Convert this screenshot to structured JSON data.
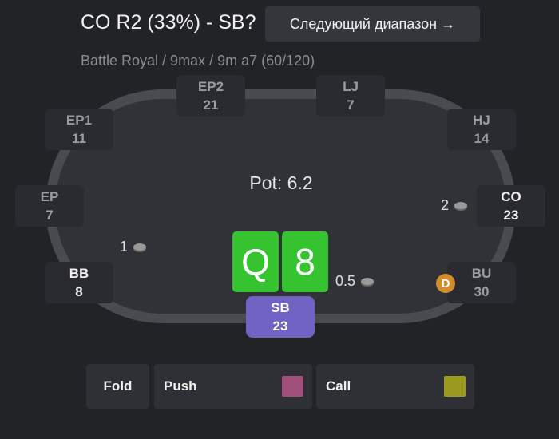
{
  "header": {
    "title": "CO R2 (33%) - SB?",
    "next_button": "Следующий диапазон →",
    "subtitle": "Battle Royal / 9max / 9m a7 (60/120)"
  },
  "table": {
    "pot": "Pot: 6.2",
    "seats": {
      "ep2": {
        "position": "EP2",
        "stack": "21"
      },
      "lj": {
        "position": "LJ",
        "stack": "7"
      },
      "ep1": {
        "position": "EP1",
        "stack": "11"
      },
      "hj": {
        "position": "HJ",
        "stack": "14"
      },
      "ep": {
        "position": "EP",
        "stack": "7"
      },
      "co": {
        "position": "CO",
        "stack": "23"
      },
      "bb": {
        "position": "BB",
        "stack": "8"
      },
      "bu": {
        "position": "BU",
        "stack": "30"
      },
      "sb": {
        "position": "SB",
        "stack": "23"
      }
    },
    "bets": {
      "co": "2",
      "bb": "1",
      "sb": "0.5"
    },
    "dealer_button": "D",
    "hero_cards": [
      "Q",
      "8"
    ],
    "card_color": "#35c430"
  },
  "actions": {
    "fold": {
      "label": "Fold"
    },
    "push": {
      "label": "Push",
      "color": "#a0507a"
    },
    "call": {
      "label": "Call",
      "color": "#9c9a1f"
    }
  }
}
